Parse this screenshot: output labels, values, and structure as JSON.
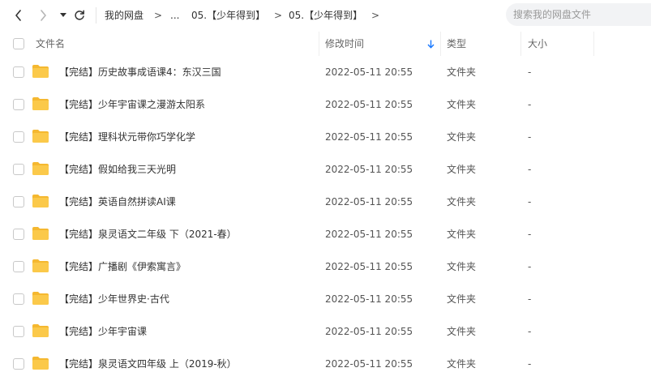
{
  "toolbar": {
    "breadcrumbs": [
      "我的网盘",
      ">",
      "...",
      "05.【少年得到】",
      ">",
      "05.【少年得到】",
      ">"
    ],
    "search_placeholder": "搜索我的网盘文件"
  },
  "table": {
    "columns": {
      "name": "文件名",
      "modified": "修改时间",
      "type": "类型",
      "size": "大小"
    },
    "rows": [
      {
        "name": "【完结】历史故事成语课4：东汉三国",
        "modified": "2022-05-11 20:55",
        "type": "文件夹",
        "size": "-"
      },
      {
        "name": "【完结】少年宇宙课之漫游太阳系",
        "modified": "2022-05-11 20:55",
        "type": "文件夹",
        "size": "-"
      },
      {
        "name": "【完结】理科状元带你巧学化学",
        "modified": "2022-05-11 20:55",
        "type": "文件夹",
        "size": "-"
      },
      {
        "name": "【完结】假如给我三天光明",
        "modified": "2022-05-11 20:55",
        "type": "文件夹",
        "size": "-"
      },
      {
        "name": "【完结】英语自然拼读AI课",
        "modified": "2022-05-11 20:55",
        "type": "文件夹",
        "size": "-"
      },
      {
        "name": "【完结】泉灵语文二年级 下（2021-春）",
        "modified": "2022-05-11 20:55",
        "type": "文件夹",
        "size": "-"
      },
      {
        "name": "【完结】广播剧《伊索寓言》",
        "modified": "2022-05-11 20:55",
        "type": "文件夹",
        "size": "-"
      },
      {
        "name": "【完结】少年世界史·古代",
        "modified": "2022-05-11 20:55",
        "type": "文件夹",
        "size": "-"
      },
      {
        "name": "【完结】少年宇宙课",
        "modified": "2022-05-11 20:55",
        "type": "文件夹",
        "size": "-"
      },
      {
        "name": "【完结】泉灵语文四年级 上（2019-秋）",
        "modified": "2022-05-11 20:55",
        "type": "文件夹",
        "size": "-"
      }
    ]
  },
  "colors": {
    "folder": "#fbc94a",
    "folder_tab": "#f5b830",
    "sort_arrow": "#1677ff"
  },
  "icons": {
    "back": "chevron-left-icon",
    "forward": "chevron-right-icon",
    "history": "caret-down-icon",
    "refresh": "refresh-icon",
    "sort": "arrow-down-icon",
    "folder": "folder-icon"
  }
}
